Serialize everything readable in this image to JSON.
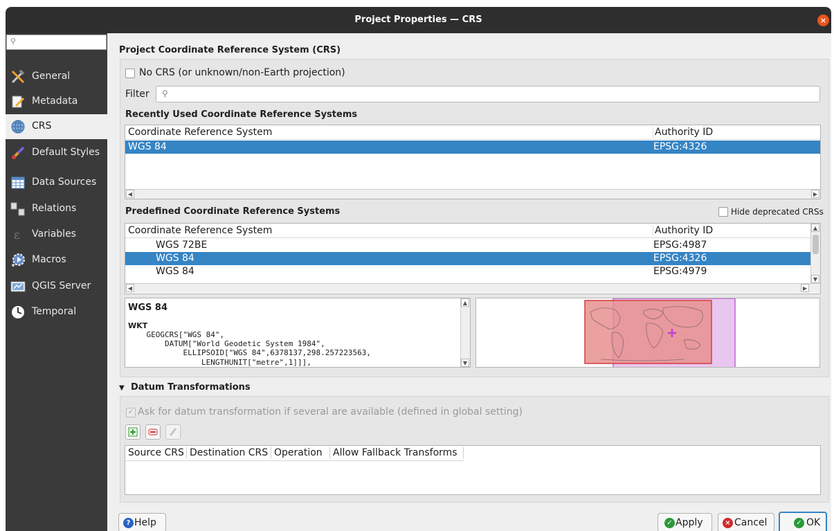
{
  "window": {
    "title": "Project Properties — CRS",
    "close_glyph": "×"
  },
  "sidebar": {
    "search_glyph": "⚲",
    "items": [
      {
        "label": "General",
        "icon": "wrench-hammer-icon"
      },
      {
        "label": "Metadata",
        "icon": "pencil-page-icon"
      },
      {
        "label": "CRS",
        "icon": "globe-icon",
        "selected": true
      },
      {
        "label": "Default Styles",
        "icon": "brush-icon"
      },
      {
        "label": "Data Sources",
        "icon": "table-icon"
      },
      {
        "label": "Relations",
        "icon": "relations-icon"
      },
      {
        "label": "Variables",
        "icon": "epsilon-icon"
      },
      {
        "label": "Macros",
        "icon": "gear-play-icon"
      },
      {
        "label": "QGIS Server",
        "icon": "server-map-icon"
      },
      {
        "label": "Temporal",
        "icon": "clock-icon"
      }
    ]
  },
  "main": {
    "section_title": "Project Coordinate Reference System (CRS)",
    "no_crs_label": "No CRS (or unknown/non-Earth projection)",
    "filter_label": "Filter",
    "filter_glyph": "⚲",
    "recent": {
      "title": "Recently Used Coordinate Reference Systems",
      "columns": [
        "Coordinate Reference System",
        "Authority ID"
      ],
      "rows": [
        {
          "name": "WGS 84",
          "id": "EPSG:4326",
          "selected": true
        }
      ]
    },
    "predefined": {
      "title": "Predefined Coordinate Reference Systems",
      "hide_deprecated_label": "Hide deprecated CRSs",
      "columns": [
        "Coordinate Reference System",
        "Authority ID"
      ],
      "rows": [
        {
          "name": "WGS 72BE",
          "id": "EPSG:4987"
        },
        {
          "name": "WGS 84",
          "id": "EPSG:4326",
          "selected": true
        },
        {
          "name": "WGS 84",
          "id": "EPSG:4979"
        }
      ]
    },
    "details": {
      "name": "WGS 84",
      "wkt_label": "WKT",
      "wkt_lines": [
        "    GEOGCRS[\"WGS 84\",",
        "        DATUM[\"World Geodetic System 1984\",",
        "            ELLIPSOID[\"WGS 84\",6378137,298.257223563,",
        "                LENGTHUNIT[\"metre\",1]]],"
      ]
    },
    "datum": {
      "title": "Datum Transformations",
      "expand_glyph": "▼",
      "ask_label": "Ask for datum transformation if several are available (defined in global setting)",
      "columns": [
        "Source CRS",
        "Destination CRS",
        "Operation",
        "Allow Fallback Transforms"
      ]
    }
  },
  "buttons": {
    "help": "Help",
    "apply": "Apply",
    "cancel": "Cancel",
    "ok": "OK"
  },
  "colors": {
    "selection": "#3584c4",
    "close": "#e95420",
    "extent_fill": "#e8908f",
    "extent_border": "#d23c3c",
    "canvas_extent": "#c060d0"
  }
}
